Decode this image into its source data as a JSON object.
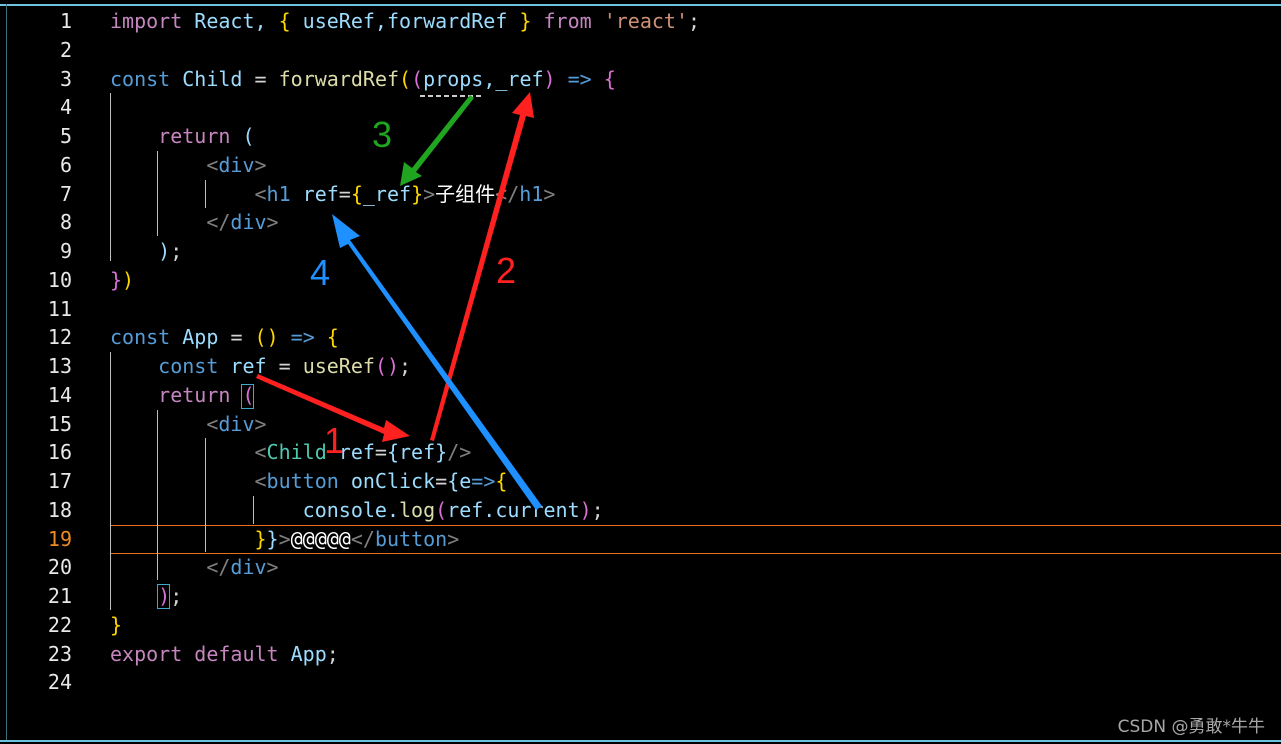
{
  "editor": {
    "active_line": 19,
    "lines": [
      [
        [
          "import",
          "kw"
        ],
        [
          " React, ",
          "var"
        ],
        [
          "{",
          "b1"
        ],
        [
          " useRef,forwardRef ",
          "var"
        ],
        [
          "}",
          "b1"
        ],
        [
          " from ",
          "kw"
        ],
        [
          "'react'",
          "str"
        ],
        [
          ";",
          "pl"
        ]
      ],
      [],
      [
        [
          "const",
          "st"
        ],
        [
          " Child ",
          "var"
        ],
        [
          "= ",
          "pl"
        ],
        [
          "forwardRef",
          "fn"
        ],
        [
          "(",
          "b1"
        ],
        [
          "(",
          "b2"
        ],
        [
          "props,_ref",
          "var"
        ],
        [
          ")",
          "b2"
        ],
        [
          " => ",
          "st"
        ],
        [
          "{",
          "b2"
        ]
      ],
      [],
      [
        [
          "    return ",
          "kw"
        ],
        [
          "(",
          "var"
        ]
      ],
      [
        [
          "        <",
          "tg"
        ],
        [
          "div",
          "tn"
        ],
        [
          ">",
          "tg"
        ]
      ],
      [
        [
          "            <",
          "tg"
        ],
        [
          "h1 ",
          "tn"
        ],
        [
          "ref",
          "var"
        ],
        [
          "=",
          "pl"
        ],
        [
          "{",
          "b1"
        ],
        [
          "_ref",
          "var"
        ],
        [
          "}",
          "b1"
        ],
        [
          ">",
          "tg"
        ],
        [
          "子组件",
          "wh"
        ],
        [
          "</",
          "tg"
        ],
        [
          "h1",
          "tn"
        ],
        [
          ">",
          "tg"
        ]
      ],
      [
        [
          "        </",
          "tg"
        ],
        [
          "div",
          "tn"
        ],
        [
          ">",
          "tg"
        ]
      ],
      [
        [
          "    )",
          "var"
        ],
        [
          ";",
          "pl"
        ]
      ],
      [
        [
          "}",
          "b2"
        ],
        [
          ")",
          "b1"
        ]
      ],
      [],
      [
        [
          "const",
          "st"
        ],
        [
          " App ",
          "var"
        ],
        [
          "= ",
          "pl"
        ],
        [
          "()",
          "b1"
        ],
        [
          " => ",
          "st"
        ],
        [
          "{",
          "b1"
        ]
      ],
      [
        [
          "    const",
          "st"
        ],
        [
          " ref ",
          "var"
        ],
        [
          "= ",
          "pl"
        ],
        [
          "useRef",
          "fn"
        ],
        [
          "()",
          "b2"
        ],
        [
          ";",
          "pl"
        ]
      ],
      [
        [
          "    return ",
          "kw"
        ],
        [
          "(",
          "b2"
        ]
      ],
      [
        [
          "        <",
          "tg"
        ],
        [
          "div",
          "tn"
        ],
        [
          ">",
          "tg"
        ]
      ],
      [
        [
          "            <",
          "tg"
        ],
        [
          "Child ",
          "cp"
        ],
        [
          "ref",
          "var"
        ],
        [
          "=",
          "pl"
        ],
        [
          "{ref}",
          "var"
        ],
        [
          "/>",
          "tg"
        ]
      ],
      [
        [
          "            <",
          "tg"
        ],
        [
          "button ",
          "tn"
        ],
        [
          "onClick",
          "var"
        ],
        [
          "=",
          "pl"
        ],
        [
          "{e",
          "var"
        ],
        [
          "=>",
          "st"
        ],
        [
          "{",
          "b1"
        ]
      ],
      [
        [
          "                console.",
          "var"
        ],
        [
          "log",
          "fn"
        ],
        [
          "(",
          "b2"
        ],
        [
          "ref.current",
          "var"
        ],
        [
          ")",
          "b2"
        ],
        [
          ";",
          "pl"
        ]
      ],
      [
        [
          "            }",
          "b1"
        ],
        [
          "}",
          "var"
        ],
        [
          ">",
          "tg"
        ],
        [
          "@@@@@",
          "wh"
        ],
        [
          "</",
          "tg"
        ],
        [
          "button",
          "tn"
        ],
        [
          ">",
          "tg"
        ]
      ],
      [
        [
          "        </",
          "tg"
        ],
        [
          "div",
          "tn"
        ],
        [
          ">",
          "tg"
        ]
      ],
      [
        [
          "    )",
          "b2"
        ],
        [
          ";",
          "pl"
        ]
      ],
      [
        [
          "}",
          "b1"
        ]
      ],
      [
        [
          "export default ",
          "kw"
        ],
        [
          "App",
          "var"
        ],
        [
          ";",
          "pl"
        ]
      ],
      []
    ]
  },
  "annotations": [
    {
      "label": "1",
      "color": "#ff2020"
    },
    {
      "label": "2",
      "color": "#ff2020"
    },
    {
      "label": "3",
      "color": "#1fa51f"
    },
    {
      "label": "4",
      "color": "#1e90ff"
    }
  ],
  "watermark": "CSDN @勇敢*牛牛",
  "colors": {
    "accent": "#6fc3df",
    "current_line": "#e8701a",
    "background": "#000000"
  }
}
